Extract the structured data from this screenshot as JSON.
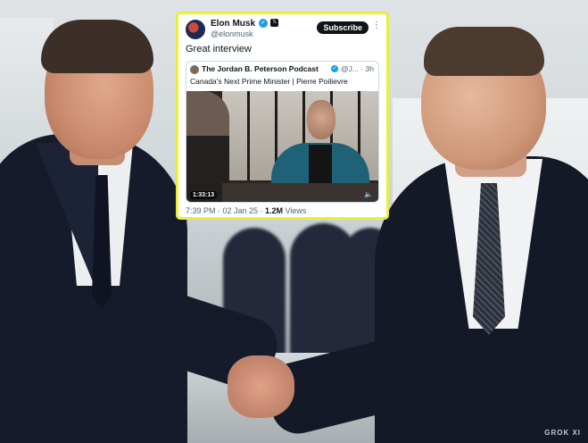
{
  "tweet": {
    "author_name": "Elon Musk",
    "author_handle": "@elonmusk",
    "verified_icon": "✓",
    "x_badge": "𝕏",
    "subscribe_label": "Subscribe",
    "more_label": "⋮",
    "text": "Great interview",
    "quote": {
      "author_name": "The Jordan B. Peterson Podcast",
      "verified_icon": "✓",
      "handle_time": "@J... · 3h",
      "text": "Canada's Next Prime Minister | Pierre Poilievre",
      "video_duration": "1:33:13",
      "mute_icon": "🔈"
    },
    "time": "7:39 PM · 02 Jan 25 · ",
    "views_count": "1.2M",
    "views_label": " Views",
    "colors": {
      "highlight_border": "#e9ef3b",
      "verified": "#1d9bf0",
      "subscribe_bg": "#0f1419"
    }
  },
  "watermark": "GROK XI"
}
